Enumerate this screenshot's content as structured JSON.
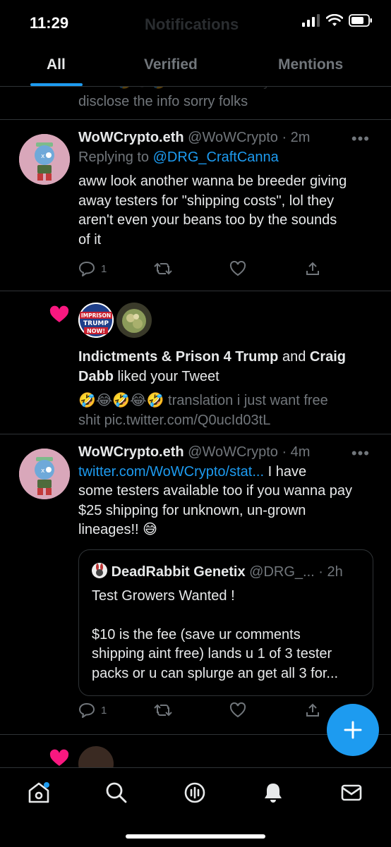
{
  "status_bar": {
    "time": "11:29",
    "faded_title": "Notifications"
  },
  "tabs": [
    {
      "label": "All"
    },
    {
      "label": "Verified"
    },
    {
      "label": "Mentions"
    }
  ],
  "partial_top": {
    "line1": "has it 🤣😂🤣 no but seriously can't",
    "line2": "disclose the info sorry folks"
  },
  "notif1": {
    "name": "WoWCrypto.eth",
    "handle": "@WoWCrypto",
    "time": "· 2m",
    "replying_prefix": "Replying to ",
    "replying_handle": "@DRG_CraftCanna",
    "lines": [
      "aww look another wanna be breeder giving",
      "away testers for \"shipping costs\", lol they",
      "aren't even your beans too by the sounds",
      "of it"
    ],
    "reply_count": "1"
  },
  "notif2": {
    "user1": "Indictments & Prison 4 Trump",
    "and": " and ",
    "user2a": "Craig",
    "user2b": "Dabb",
    "liked": " liked your Tweet",
    "emojis": "🤣😂🤣😂🤣",
    "tweet_line1": " translation i just want free",
    "tweet_line2": "shit pic.twitter.com/Q0ucId03tL",
    "badge_lines": [
      "IMPRISON",
      "TRUMP",
      "NOW!"
    ]
  },
  "notif3": {
    "name": "WoWCrypto.eth",
    "handle": "@WoWCrypto",
    "time": "· 4m",
    "link": "twitter.com/WoWCrypto/stat...",
    "line1_rest": " I have",
    "lines": [
      "some testers available too if you wanna pay",
      "$25 shipping for unknown, un-grown",
      "lineages!!  😅"
    ],
    "quote": {
      "name": "DeadRabbit Genetix",
      "handle": "@DRG_...",
      "time": "· 2h",
      "lines": [
        "Test Growers Wanted !",
        "",
        "$10 is the fee (save ur comments",
        "shipping aint free) lands u 1 of 3 tester",
        "packs or u can splurge an get all 3 for..."
      ]
    },
    "reply_count": "1"
  },
  "colors": {
    "accent": "#1d9bf0",
    "like": "#f91880",
    "muted": "#71767b",
    "divider": "#2f3336"
  }
}
